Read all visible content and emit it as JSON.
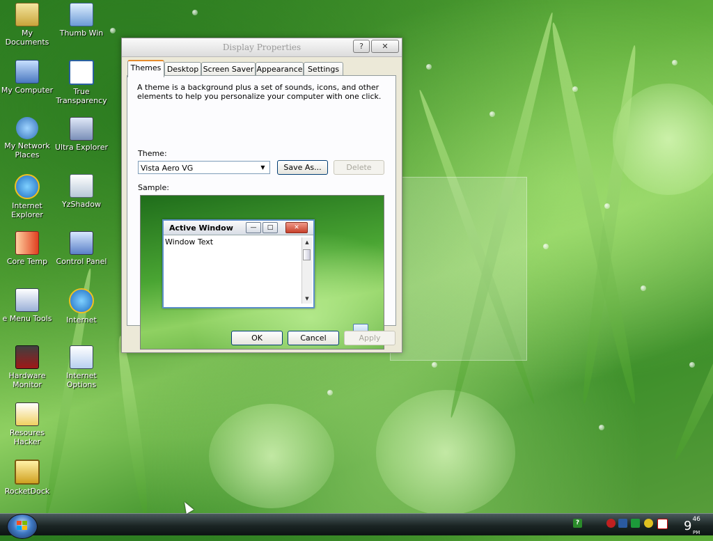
{
  "desktop": {
    "icons": [
      {
        "label": "My Documents",
        "icon": "folder-documents-icon"
      },
      {
        "label": "Thumb Win",
        "icon": "thumb-win-icon"
      },
      {
        "label": "My Computer",
        "icon": "computer-icon"
      },
      {
        "label": "True Transparency",
        "icon": "true-transparency-icon"
      },
      {
        "label": "My Network Places",
        "icon": "network-places-icon"
      },
      {
        "label": "Ultra Explorer",
        "icon": "ultra-explorer-icon"
      },
      {
        "label": "Internet Explorer",
        "icon": "internet-explorer-icon"
      },
      {
        "label": "YzShadow",
        "icon": "yzshadow-icon"
      },
      {
        "label": "Core Temp",
        "icon": "thermometer-icon"
      },
      {
        "label": "Control Panel",
        "icon": "control-panel-icon"
      },
      {
        "label": "e Menu Tools",
        "icon": "menu-tools-icon"
      },
      {
        "label": "Internet",
        "icon": "internet-explorer-icon"
      },
      {
        "label": "Hardware Monitor",
        "icon": "hardware-monitor-icon"
      },
      {
        "label": "Internet Options",
        "icon": "internet-options-icon"
      },
      {
        "label": "Resoures Hacker",
        "icon": "resource-hacker-icon"
      },
      {
        "label": "RocketDock",
        "icon": "rocketdock-icon"
      }
    ]
  },
  "dialog": {
    "title": "Display Properties",
    "help_glyph": "?",
    "close_glyph": "✕",
    "tabs": [
      {
        "label": "Themes",
        "active": true
      },
      {
        "label": "Desktop",
        "active": false
      },
      {
        "label": "Screen Saver",
        "active": false
      },
      {
        "label": "Appearance",
        "active": false
      },
      {
        "label": "Settings",
        "active": false
      }
    ],
    "description": "A theme is a background plus a set of sounds, icons, and other elements to help you personalize your computer with one click.",
    "theme_label": "Theme:",
    "theme_value": "Vista Aero VG",
    "save_as_label": "Save As...",
    "delete_label": "Delete",
    "sample_label": "Sample:",
    "sample_window": {
      "title": "Active Window",
      "text": "Window Text"
    },
    "ok_label": "OK",
    "cancel_label": "Cancel",
    "apply_label": "Apply"
  },
  "taskbar": {
    "tray_icons": [
      "help-icon",
      "security-shield-icon",
      "network-icon",
      "check-icon",
      "smiley-icon",
      "first-aid-icon"
    ],
    "help_glyph": "?",
    "clock_hour": "9",
    "clock_minutes": "46",
    "clock_ampm": "PM"
  },
  "colors": {
    "accent_tab": "#e68b2c",
    "button_border": "#003c74",
    "taskbar": "#1b2524"
  }
}
